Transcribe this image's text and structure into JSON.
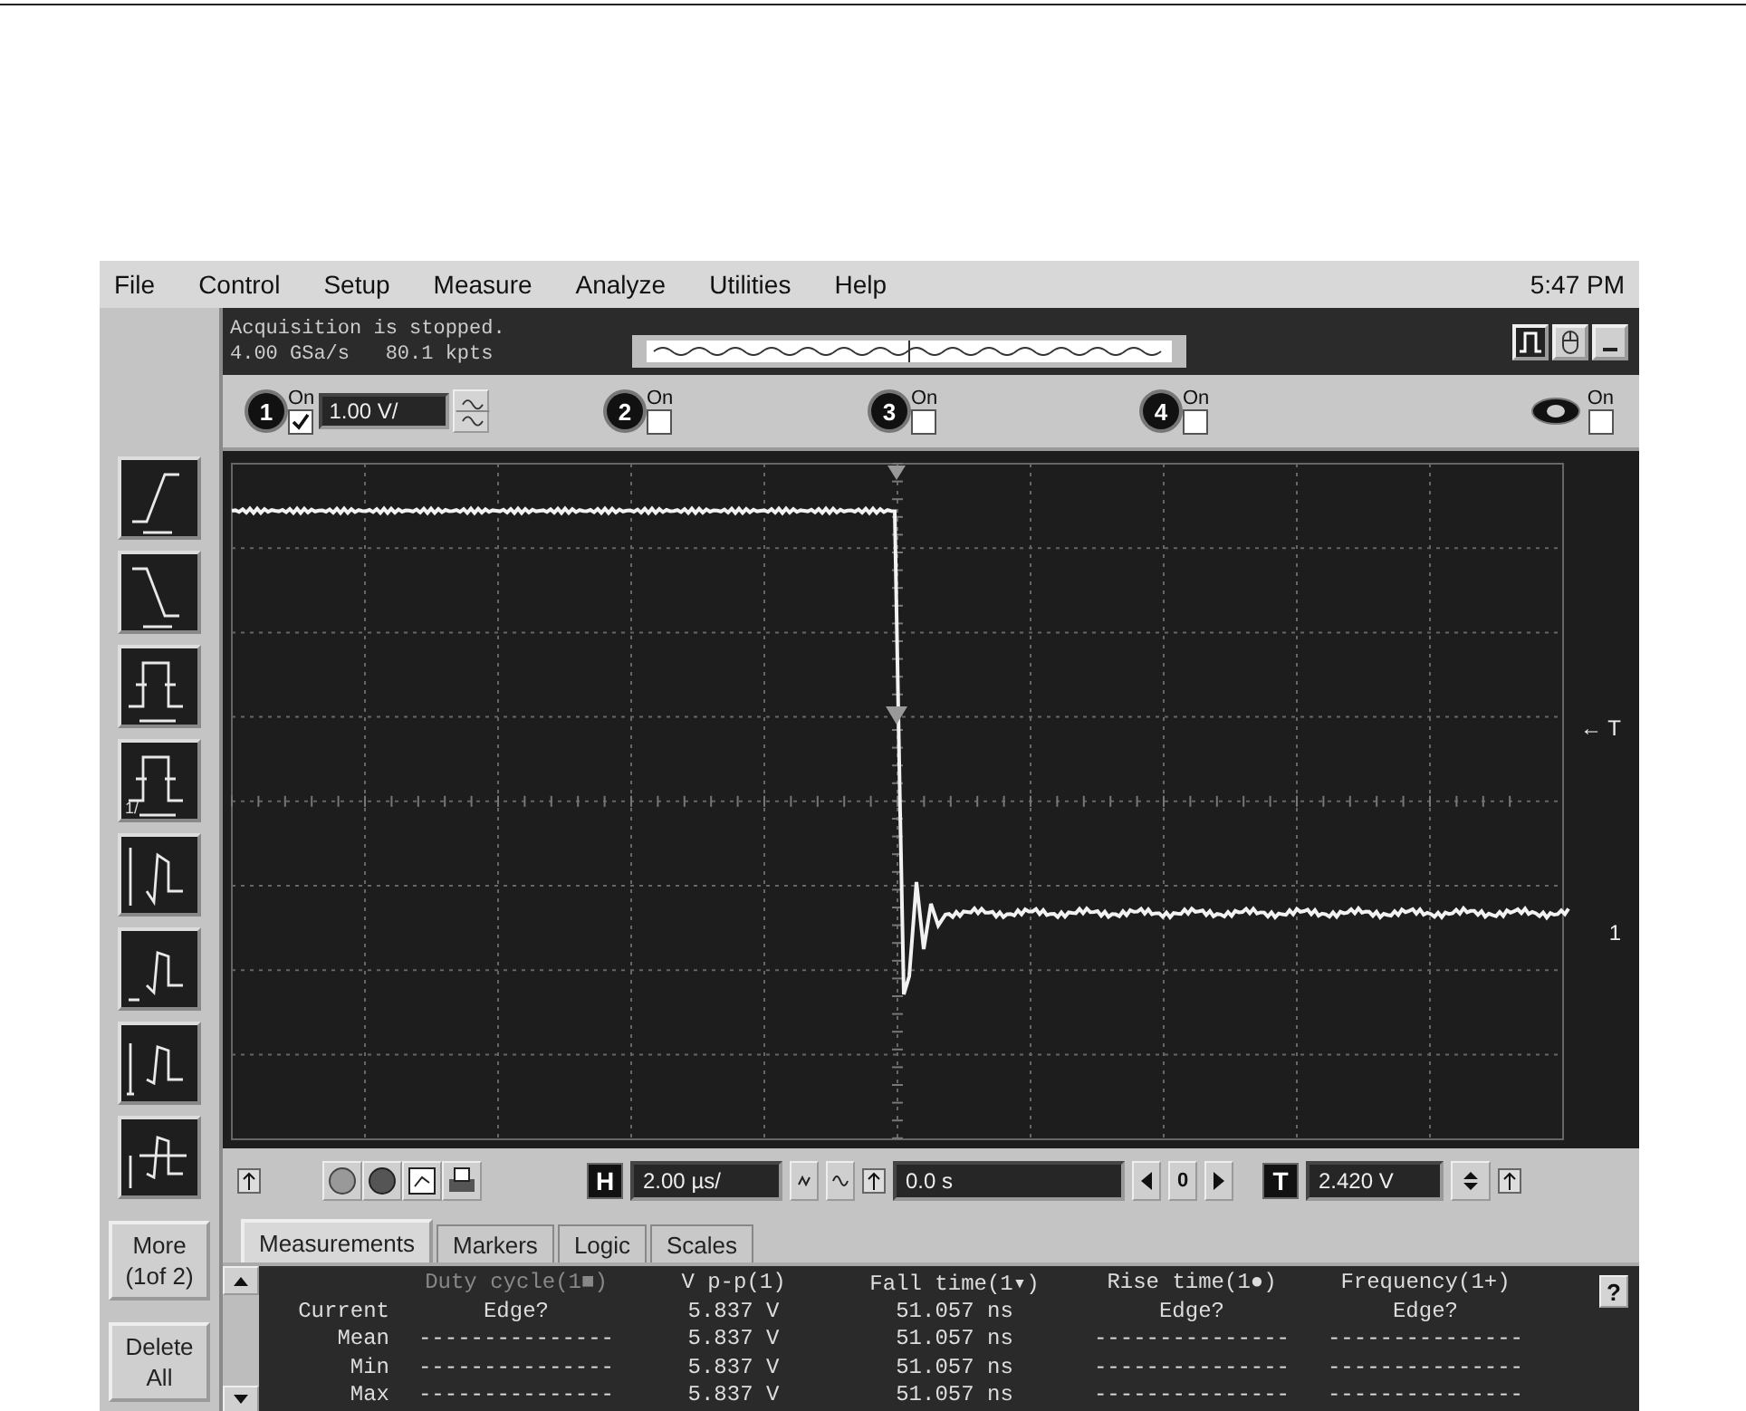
{
  "menu": {
    "items": [
      "File",
      "Control",
      "Setup",
      "Measure",
      "Analyze",
      "Utilities",
      "Help"
    ],
    "clock": "5:47 PM"
  },
  "status": {
    "lines": [
      "Acquisition is stopped.",
      "4.00 GSa/s   80.1 kpts"
    ]
  },
  "tools": [
    {
      "kind": "rise"
    },
    {
      "kind": "fall"
    },
    {
      "kind": "width"
    },
    {
      "kind": "period",
      "label": "1/"
    },
    {
      "kind": "vpp"
    },
    {
      "kind": "base"
    },
    {
      "kind": "top"
    },
    {
      "kind": "avg"
    }
  ],
  "side_buttons": [
    {
      "lines": [
        "More",
        "(1of 2)"
      ]
    },
    {
      "lines": [
        "Delete",
        "All"
      ]
    }
  ],
  "channels": [
    {
      "number": "1",
      "kind": "analog",
      "on_label": "On",
      "checked": true,
      "scale": "1.00 V/"
    },
    {
      "number": "2",
      "kind": "analog",
      "on_label": "On",
      "checked": false
    },
    {
      "number": "3",
      "kind": "analog",
      "on_label": "On",
      "checked": false
    },
    {
      "number": "4",
      "kind": "analog",
      "on_label": "On",
      "checked": false
    },
    {
      "kind": "math",
      "on_label": "On",
      "checked": false
    }
  ],
  "scope": {
    "markers": [
      {
        "kind": "trigger",
        "label": "← T"
      },
      {
        "kind": "ground",
        "label": "1"
      }
    ]
  },
  "controls": {
    "horizontal_label": "H",
    "timebase": "2.00 µs/",
    "delay": "0.0 s",
    "delay_center": "0",
    "trigger_label": "T",
    "trigger_level": "2.420 V"
  },
  "tabs": [
    {
      "label": "Measurements",
      "selected": true
    },
    {
      "label": "Markers",
      "selected": false
    },
    {
      "label": "Logic",
      "selected": false
    },
    {
      "label": "Scales",
      "selected": false
    }
  ],
  "table": {
    "columns": [
      {
        "label": "Duty cycle(1■)",
        "dimmed": true
      },
      {
        "label": "V p-p(1)",
        "dimmed": false
      },
      {
        "label": "Fall time(1▾)",
        "dimmed": false
      },
      {
        "label": "Rise time(1●)",
        "dimmed": false
      },
      {
        "label": "Frequency(1+)",
        "dimmed": false
      }
    ],
    "rows": [
      {
        "label": "Current",
        "cells": [
          "Edge?",
          "5.837 V",
          "51.057 ns",
          "Edge?",
          "Edge?"
        ]
      },
      {
        "label": "Mean",
        "cells": [
          "---------------",
          "5.837 V",
          "51.057 ns",
          "---------------",
          "---------------"
        ]
      },
      {
        "label": "Min",
        "cells": [
          "---------------",
          "5.837 V",
          "51.057 ns",
          "---------------",
          "---------------"
        ]
      },
      {
        "label": "Max",
        "cells": [
          "---------------",
          "5.837 V",
          "51.057 ns",
          "---------------",
          "---------------"
        ]
      }
    ],
    "help": "?"
  }
}
